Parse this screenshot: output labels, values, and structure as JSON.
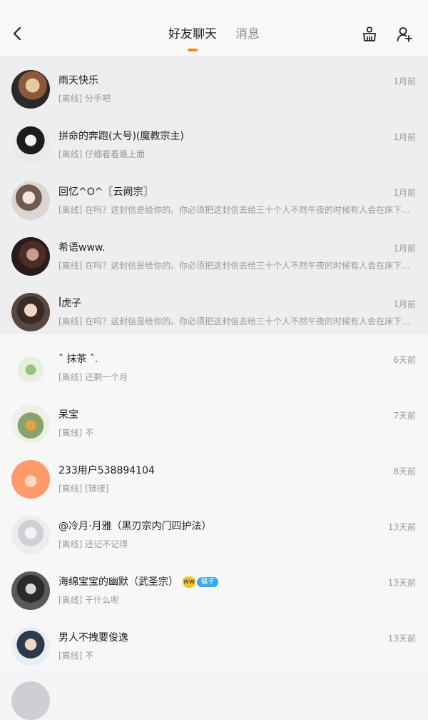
{
  "header": {
    "tabs": [
      {
        "label": "好友聊天",
        "active": true
      },
      {
        "label": "消息",
        "active": false
      }
    ],
    "accent_color": "#f08c1b",
    "icons": {
      "back": "back-arrow-icon",
      "clean": "broom-icon",
      "add_friend": "add-user-icon"
    }
  },
  "chats": [
    {
      "name": "雨天快乐",
      "message": "[离线] 分手吧",
      "time": "1月前",
      "highlighted": true
    },
    {
      "name": "拼命的奔跑(大号)(魔教宗主)",
      "message": "[离线] 仔细看看最上面",
      "time": "1月前",
      "highlighted": true
    },
    {
      "name": "回忆^O^〖云阙宗〗",
      "message": "[离线] 在吗？这封信是给你的。你必须把这封信去给三十个人不然午夜的时候有人会在床下叫你的名字",
      "time": "1月前",
      "highlighted": true
    },
    {
      "name": "希语www.",
      "message": "[离线] 在吗？这封信是给你的。你必须把这封信去给三十个人不然午夜的时候有人会在床下叫你的名字",
      "time": "1月前",
      "highlighted": true
    },
    {
      "name": "ꟾ虎子",
      "message": "[离线] 在吗？这封信是给你的。你必须把这封信去给三十个人不然午夜的时候有人会在床下叫你的名字",
      "time": "1月前",
      "highlighted": true
    },
    {
      "name": "ˆ 抹茶 ˆ.",
      "message": "[离线] 还剩一个月",
      "time": "6天前",
      "highlighted": false
    },
    {
      "name": "呆宝",
      "message": "[离线] 不",
      "time": "7天前",
      "highlighted": false
    },
    {
      "name": "233用户538894104",
      "message": "[离线] [链接]",
      "time": "8天前",
      "highlighted": false
    },
    {
      "name": "@冷月·月雅（黑刃宗内门四护法）",
      "message": "[离线] 还记不记得",
      "time": "13天前",
      "highlighted": false
    },
    {
      "name": "海绵宝宝的幽默（武圣宗）",
      "message": "[离线] 干什么呢",
      "time": "13天前",
      "highlighted": false,
      "badge": {
        "emoji": "ww",
        "tag": "福子"
      }
    },
    {
      "name": "男人不拽要俊逸",
      "message": "[离线] 不",
      "time": "13天前",
      "highlighted": false
    }
  ]
}
